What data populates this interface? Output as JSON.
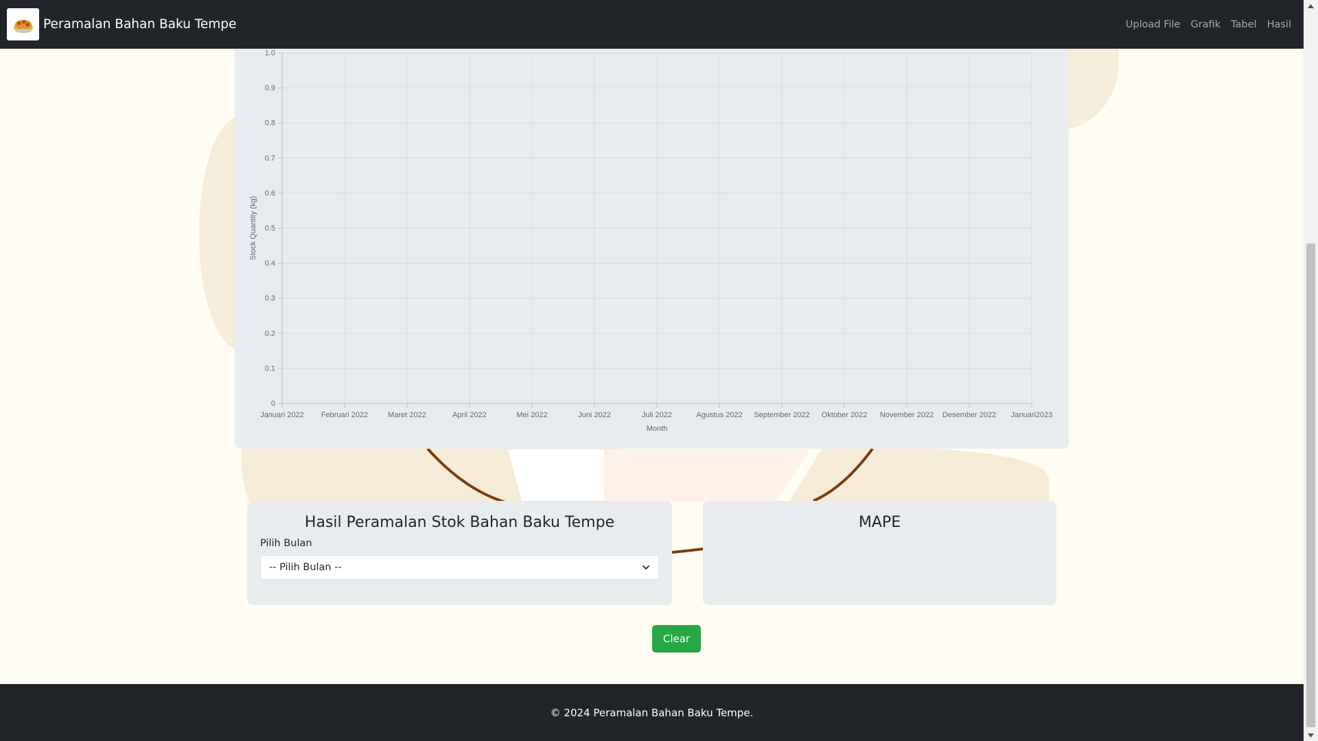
{
  "navbar": {
    "brand": "Peramalan Bahan Baku Tempe",
    "links": [
      "Upload File",
      "Grafik",
      "Tabel",
      "Hasil"
    ]
  },
  "chart_data": {
    "type": "line",
    "categories": [
      "Januari 2022",
      "Februari 2022",
      "Maret 2022",
      "April 2022",
      "Mei 2022",
      "Juni 2022",
      "Juli 2022",
      "Agustus 2022",
      "September 2022",
      "Oktober 2022",
      "November 2022",
      "Desember 2022",
      "Januari2023"
    ],
    "series": [],
    "xlabel": "Month",
    "ylabel": "Stock Quantity (kg)",
    "yticks": [
      "0",
      "0.1",
      "0.2",
      "0.3",
      "0.4",
      "0.5",
      "0.6",
      "0.7",
      "0.8",
      "0.9",
      "1.0"
    ],
    "ylim": [
      0,
      1.0
    ],
    "grid": true
  },
  "forecast": {
    "title": "Hasil Peramalan Stok Bahan Baku Tempe",
    "label": "Pilih Bulan",
    "selected": "-- Pilih Bulan --"
  },
  "mape": {
    "title": "MAPE"
  },
  "clear_label": "Clear",
  "footer": "© 2024 Peramalan Bahan Baku Tempe.",
  "colors": {
    "navbar": "#212529",
    "background": "#fffcf3",
    "card": "#e9ecef",
    "button": "#28a745",
    "decor_ring": "#7a3b12"
  }
}
